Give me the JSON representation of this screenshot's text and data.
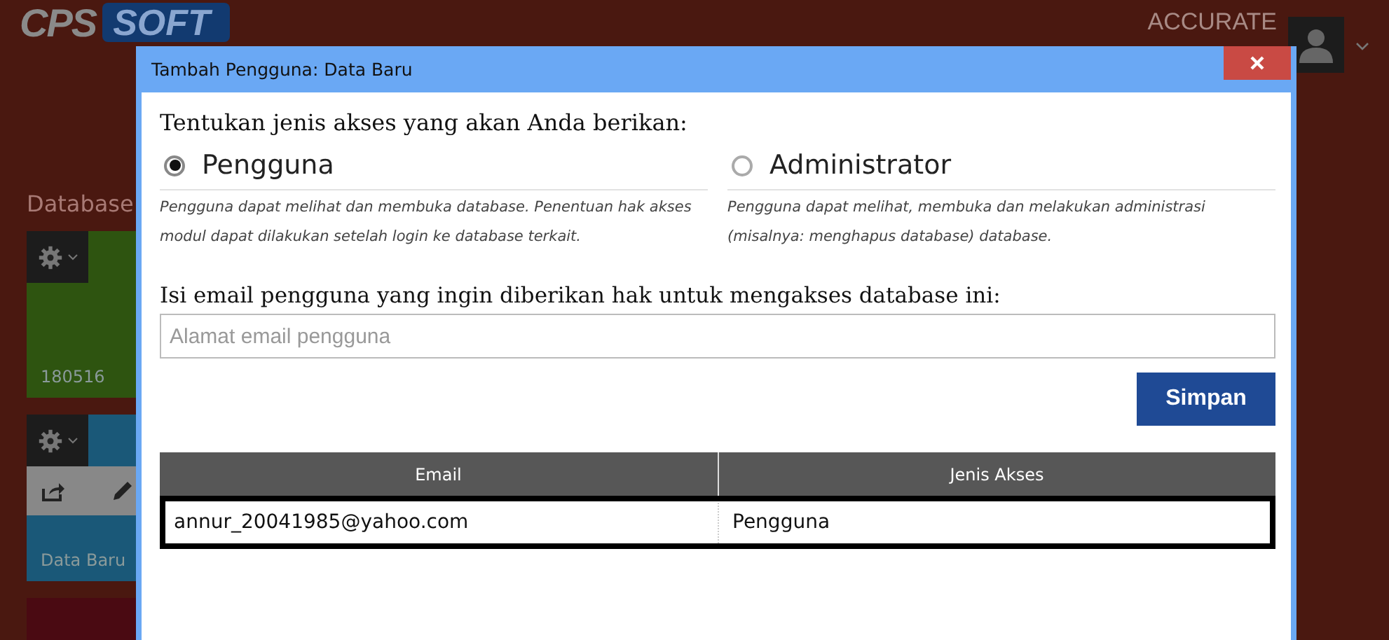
{
  "app": {
    "logo": {
      "part_1": "CPS",
      "part_2": "SOFT"
    },
    "company": "ACCURATE",
    "section_title": "Database",
    "tiles": [
      {
        "label": "180516",
        "color": "#2e5410",
        "actions": false
      },
      {
        "label": "Data Baru",
        "color": "#1a5878",
        "actions": true
      },
      {
        "color": "#4a0a12"
      }
    ]
  },
  "dialog": {
    "title": "Tambah Pengguna: Data Baru",
    "prompt": "Tentukan jenis akses yang akan Anda berikan:",
    "options": [
      {
        "label": "Pengguna",
        "selected": true,
        "description": "Pengguna dapat melihat dan membuka database. Penentuan hak akses modul dapat dilakukan setelah login ke database terkait."
      },
      {
        "label": "Administrator",
        "selected": false,
        "description": "Pengguna dapat melihat, membuka dan melakukan administrasi (misalnya: menghapus database) database."
      }
    ],
    "email_prompt": "Isi email pengguna yang ingin diberikan hak untuk mengakses database ini:",
    "email_field": {
      "placeholder": "Alamat email pengguna"
    },
    "save_button": "Simpan",
    "table": {
      "columns": [
        "Email",
        "Jenis Akses"
      ],
      "rows": [
        {
          "cells": [
            "annur_20041985@yahoo.com",
            "Pengguna"
          ],
          "selected": true
        }
      ]
    }
  }
}
